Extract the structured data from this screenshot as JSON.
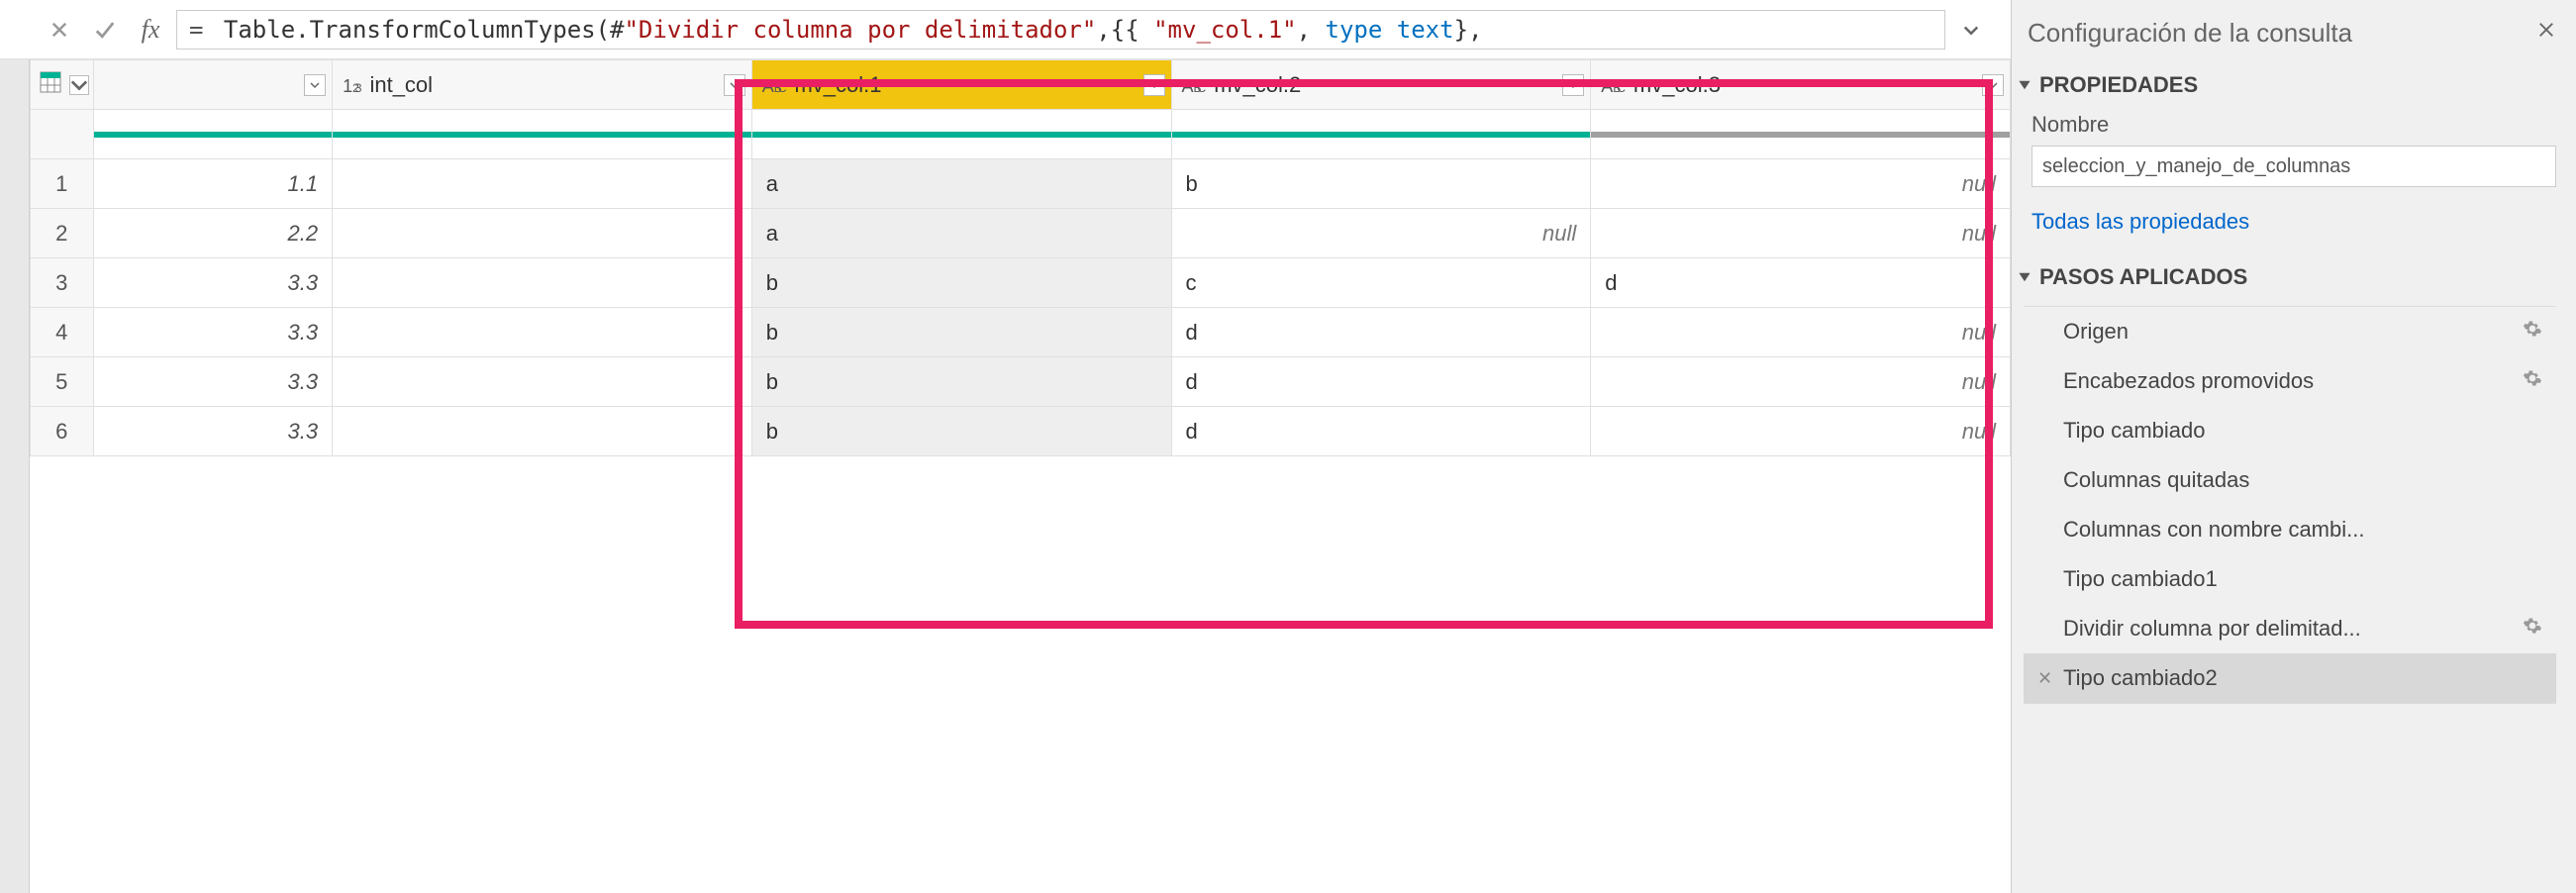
{
  "formula": {
    "prefix": "= ",
    "part1": "Table.TransformColumnTypes(#",
    "str1": "\"Dividir columna por delimitador\"",
    "part2": ",{{ ",
    "str2": "\"mv_col.1\"",
    "part3": ", ",
    "type1": "type text",
    "part4": "},"
  },
  "columns": [
    {
      "name": "",
      "dtype": "index",
      "selected": false,
      "quality": "green"
    },
    {
      "name": "int_col",
      "dtype": "num",
      "selected": false,
      "quality": "green"
    },
    {
      "name": "mv_col.1",
      "dtype": "abc",
      "selected": true,
      "quality": "green"
    },
    {
      "name": "mv_col.2",
      "dtype": "abc",
      "selected": false,
      "quality": "green"
    },
    {
      "name": "mv_col.3",
      "dtype": "abc",
      "selected": false,
      "quality": "gray"
    }
  ],
  "rows": [
    {
      "n": "1",
      "c0": "1.1",
      "c1": "a",
      "c2": "b",
      "c3": null
    },
    {
      "n": "2",
      "c0": "2.2",
      "c1": "a",
      "c2": null,
      "c3": null
    },
    {
      "n": "3",
      "c0": "3.3",
      "c1": "b",
      "c2": "c",
      "c3": "d"
    },
    {
      "n": "4",
      "c0": "3.3",
      "c1": "b",
      "c2": "d",
      "c3": null
    },
    {
      "n": "5",
      "c0": "3.3",
      "c1": "b",
      "c2": "d",
      "c3": null
    },
    {
      "n": "6",
      "c0": "3.3",
      "c1": "b",
      "c2": "d",
      "c3": null
    }
  ],
  "null_text": "null",
  "sidebar": {
    "title": "Configuración de la consulta",
    "properties_header": "PROPIEDADES",
    "name_label": "Nombre",
    "name_value": "seleccion_y_manejo_de_columnas",
    "all_props_link": "Todas las propiedades",
    "steps_header": "PASOS APLICADOS",
    "steps": [
      {
        "label": "Origen",
        "gear": true,
        "x": false,
        "active": false
      },
      {
        "label": "Encabezados promovidos",
        "gear": true,
        "x": false,
        "active": false
      },
      {
        "label": "Tipo cambiado",
        "gear": false,
        "x": false,
        "active": false
      },
      {
        "label": "Columnas quitadas",
        "gear": false,
        "x": false,
        "active": false
      },
      {
        "label": "Columnas con nombre cambi...",
        "gear": false,
        "x": false,
        "active": false
      },
      {
        "label": "Tipo cambiado1",
        "gear": false,
        "x": false,
        "active": false
      },
      {
        "label": "Dividir columna por delimitad...",
        "gear": true,
        "x": false,
        "active": false
      },
      {
        "label": "Tipo cambiado2",
        "gear": false,
        "x": true,
        "active": true
      }
    ]
  }
}
